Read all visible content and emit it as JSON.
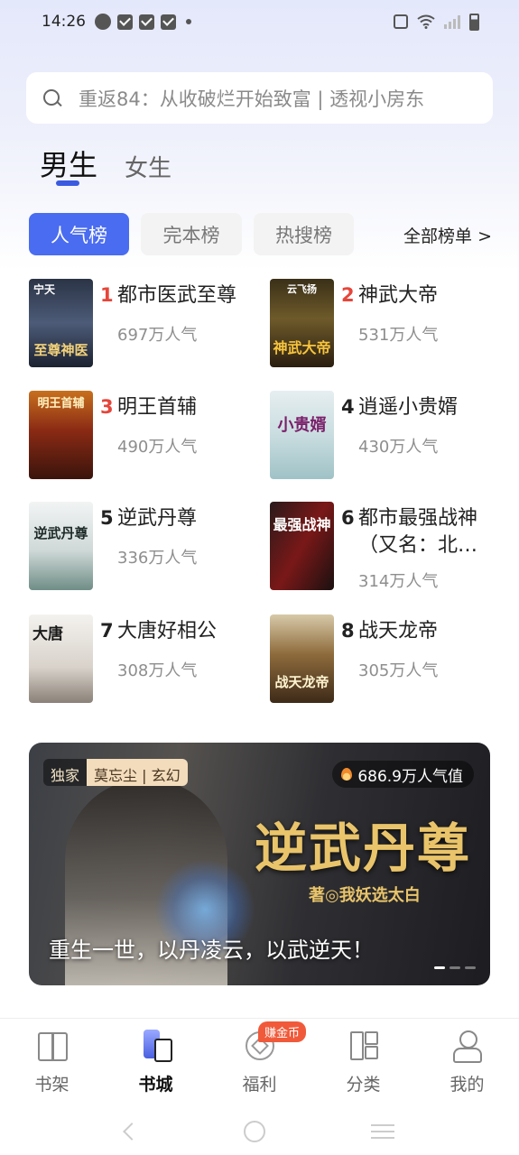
{
  "status_bar": {
    "time": "14:26"
  },
  "search": {
    "placeholder": "重返84：从收破烂开始致富 | 透视小房东"
  },
  "gender_tabs": [
    {
      "label": "男生",
      "active": true
    },
    {
      "label": "女生",
      "active": false
    }
  ],
  "rank_tabs": [
    {
      "label": "人气榜",
      "active": true
    },
    {
      "label": "完本榜",
      "active": false
    },
    {
      "label": "热搜榜",
      "active": false
    }
  ],
  "all_lists_label": "全部榜单 >",
  "books": [
    {
      "rank": "1",
      "title": "都市医武至尊",
      "popularity": "697万人气",
      "cover_text": "至尊神医",
      "cover_top": "宁天"
    },
    {
      "rank": "2",
      "title": "神武大帝",
      "popularity": "531万人气",
      "cover_text": "神武大帝",
      "cover_top": "云飞扬"
    },
    {
      "rank": "3",
      "title": "明王首辅",
      "popularity": "490万人气",
      "cover_text": "",
      "cover_top": "明王首辅"
    },
    {
      "rank": "4",
      "title": "逍遥小贵婿",
      "popularity": "430万人气",
      "cover_text": "小贵婿",
      "cover_top": ""
    },
    {
      "rank": "5",
      "title": "逆武丹尊",
      "popularity": "336万人气",
      "cover_text": "逆武丹尊",
      "cover_top": ""
    },
    {
      "rank": "6",
      "title": "都市最强战神（又名：北…",
      "popularity": "314万人气",
      "cover_text": "最强战神",
      "cover_top": ""
    },
    {
      "rank": "7",
      "title": "大唐好相公",
      "popularity": "308万人气",
      "cover_text": "大唐",
      "cover_top": ""
    },
    {
      "rank": "8",
      "title": "战天龙帝",
      "popularity": "305万人气",
      "cover_text": "战天龙帝",
      "cover_top": ""
    }
  ],
  "banner": {
    "exclusive": "独家",
    "meta": "莫忘尘 | 玄幻",
    "popularity": "686.9万人气值",
    "title": "逆武丹尊",
    "author": "著◎我妖选太白",
    "slogan": "重生一世，以丹凌云，以武逆天！"
  },
  "bottom_nav": [
    {
      "label": "书架",
      "icon": "bookshelf-icon",
      "active": false
    },
    {
      "label": "书城",
      "icon": "bookstore-icon",
      "active": true
    },
    {
      "label": "福利",
      "icon": "welfare-icon",
      "active": false,
      "badge": "赚金币"
    },
    {
      "label": "分类",
      "icon": "category-icon",
      "active": false
    },
    {
      "label": "我的",
      "icon": "profile-icon",
      "active": false
    }
  ],
  "colors": {
    "accent": "#4a6cf0",
    "rank_top": "#e6453a",
    "badge": "#f05a3a",
    "banner_title": "#e9c46a"
  }
}
